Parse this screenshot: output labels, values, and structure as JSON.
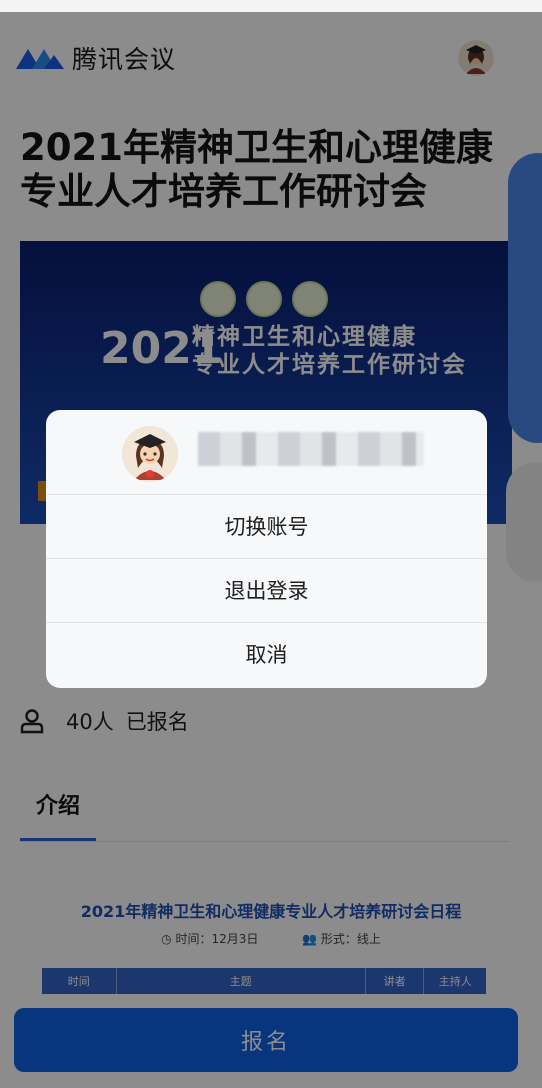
{
  "app": {
    "name": "腾讯会议",
    "brand_color": "#1b5de6"
  },
  "header": {
    "avatar_icon": "user-avatar-graduate"
  },
  "meeting": {
    "title": "2021年精神卫生和心理健康专业人才培养工作研讨会",
    "banner": {
      "year": "2021",
      "title_line1": "精神卫生和心理健康",
      "title_line2": "专业人才培养工作研讨会"
    },
    "enrollment": {
      "count": "40人",
      "label": "已报名"
    }
  },
  "tabs": [
    {
      "label": "介绍",
      "active": true
    }
  ],
  "schedule": {
    "title": "2021年精神卫生和心理健康专业人才培养研讨会日程",
    "time_text": "时间：12月3日",
    "format_text": "形式：线上",
    "columns": [
      "时间",
      "主题",
      "讲者",
      "主持人"
    ]
  },
  "signup_button": {
    "label": "报名",
    "color": "#0d62e6"
  },
  "account_sheet": {
    "avatar_icon": "user-avatar-graduate",
    "options": [
      {
        "label": "切换账号"
      },
      {
        "label": "退出登录"
      },
      {
        "label": "取消"
      }
    ]
  }
}
